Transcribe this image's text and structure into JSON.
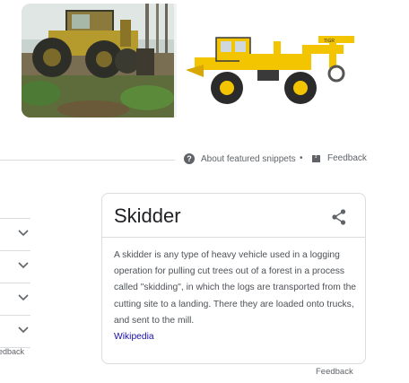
{
  "images": {
    "left_alt": "",
    "right_alt": ""
  },
  "snippet_bar": {
    "about_label": "About featured snippets",
    "separator": "•",
    "feedback_label": "Feedback"
  },
  "accordion": {
    "items": [
      {
        "icon": "chevron-down-icon"
      },
      {
        "icon": "chevron-down-icon"
      },
      {
        "icon": "chevron-down-icon"
      },
      {
        "icon": "chevron-down-icon"
      }
    ],
    "feedback_label": "edback"
  },
  "knowledge_panel": {
    "title": "Skidder",
    "description": "A skidder is any type of heavy vehicle used in a logging operation for pulling cut trees out of a forest in a process called \"skidding\", in which the logs are transported from the cutting site to a landing. There they are loaded onto trucks, and sent to the mill.",
    "source_link": "Wikipedia",
    "feedback_label": "Feedback"
  },
  "colors": {
    "link": "#1a0dab",
    "text_secondary": "#5f6368",
    "border": "#dadce0",
    "skidder_yellow": "#f2c500"
  }
}
